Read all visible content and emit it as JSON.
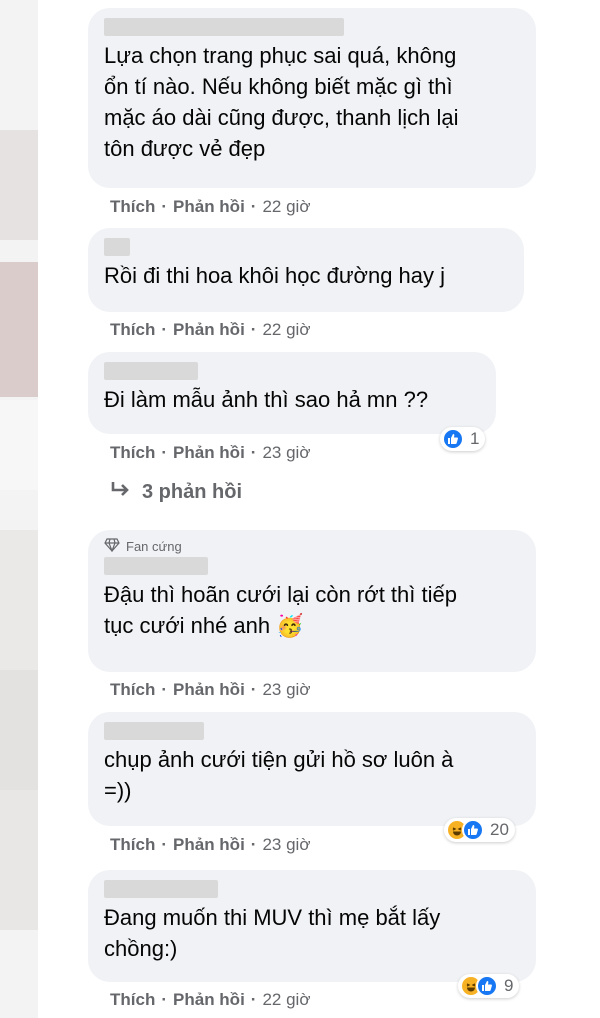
{
  "actions": {
    "like": "Thích",
    "reply": "Phản hồi"
  },
  "comments": [
    {
      "text": "Lựa chọn trang phục sai quá, không\nổn tí nào. Nếu không biết mặc gì thì\nmặc áo dài cũng được, thanh lịch lại\ntôn được vẻ đẹp",
      "time": "22 giờ"
    },
    {
      "text": "Rồi đi thi hoa khôi học đường hay j",
      "time": "22 giờ"
    },
    {
      "text": "Đi làm mẫu ảnh thì sao hả mn ??",
      "time": "23 giờ",
      "reaction_count": "1",
      "reaction_icons": [
        "like-icon"
      ]
    },
    {
      "badge": "Fan cứng",
      "text": "Đậu thì hoãn cưới lại còn rớt thì tiếp\ntục cưới nhé anh",
      "emoji": "🥳",
      "time": "23 giờ"
    },
    {
      "text": "chụp ảnh cưới tiện gửi hồ sơ luôn à\n=))",
      "time": "23 giờ",
      "reaction_count": "20",
      "reaction_icons": [
        "haha-icon",
        "like-icon"
      ]
    },
    {
      "text": "Đang muốn thi MUV thì mẹ bắt lấy\nchồng:)",
      "time": "22 giờ",
      "reaction_count": "9",
      "reaction_icons": [
        "haha-icon",
        "like-icon"
      ]
    }
  ],
  "view_replies": "3 phản hồi",
  "colors": {
    "bubble": "#f0f2f5",
    "meta": "#65676b",
    "like": "#1877f2",
    "haha": "#f7b125"
  }
}
